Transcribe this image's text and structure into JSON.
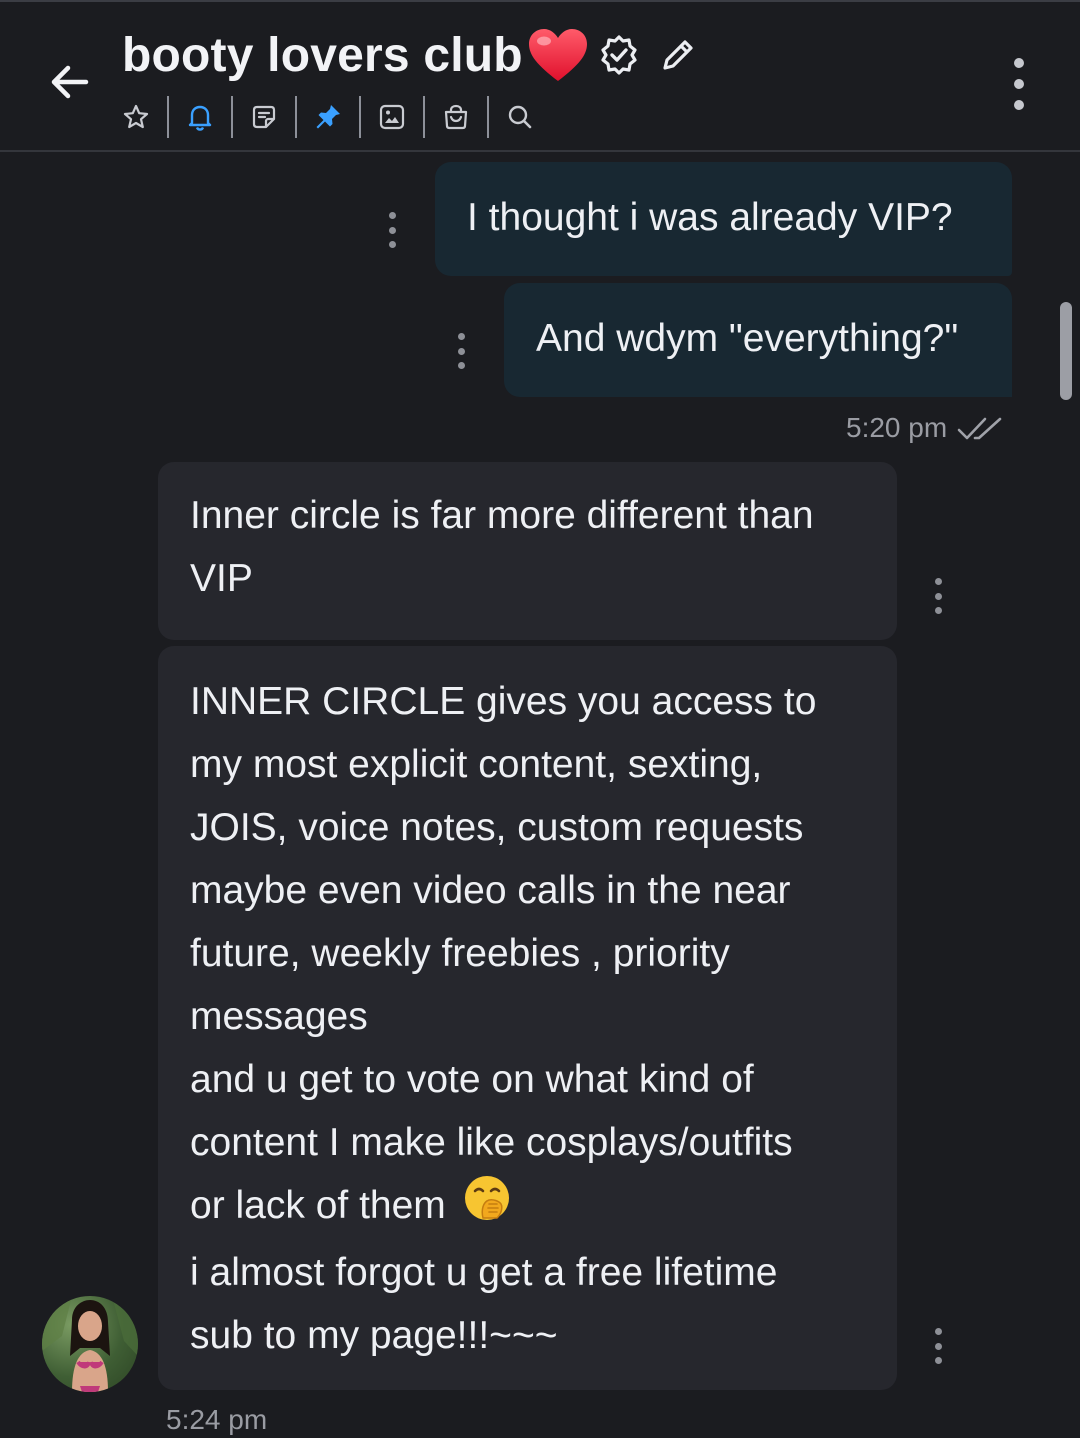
{
  "header": {
    "title": "booty lovers club",
    "title_icons": [
      "heart-emoji-icon",
      "verified-badge-icon",
      "edit-pencil-icon"
    ],
    "toolbar_icons": [
      "star-icon",
      "bell-icon",
      "note-icon",
      "pin-icon",
      "image-icon",
      "shop-bag-icon",
      "search-icon"
    ],
    "accent_color": "#3aa0ff"
  },
  "messages": [
    {
      "direction": "outgoing",
      "text": "I thought i was already VIP?"
    },
    {
      "direction": "outgoing",
      "text": "And wdym \"everything?\""
    },
    {
      "direction": "incoming",
      "text": "Inner circle is far more different than VIP"
    },
    {
      "direction": "incoming",
      "lines": [
        "INNER CIRCLE gives you access to",
        "my most explicit content, sexting,",
        "JOIS, voice notes, custom requests",
        "maybe even video calls in the near",
        "future, weekly freebies , priority",
        "messages",
        "and u get to vote on what kind of",
        "content I make like cosplays/outfits",
        "or lack of them",
        "i almost forgot u get a free lifetime",
        "sub to my page!!!~~~"
      ]
    }
  ],
  "outgoing_time": "5:20 pm",
  "incoming_time": "5:24 pm",
  "colors": {
    "background": "#1b1c20",
    "outgoing_bubble": "#182832",
    "incoming_bubble": "#26272d"
  }
}
